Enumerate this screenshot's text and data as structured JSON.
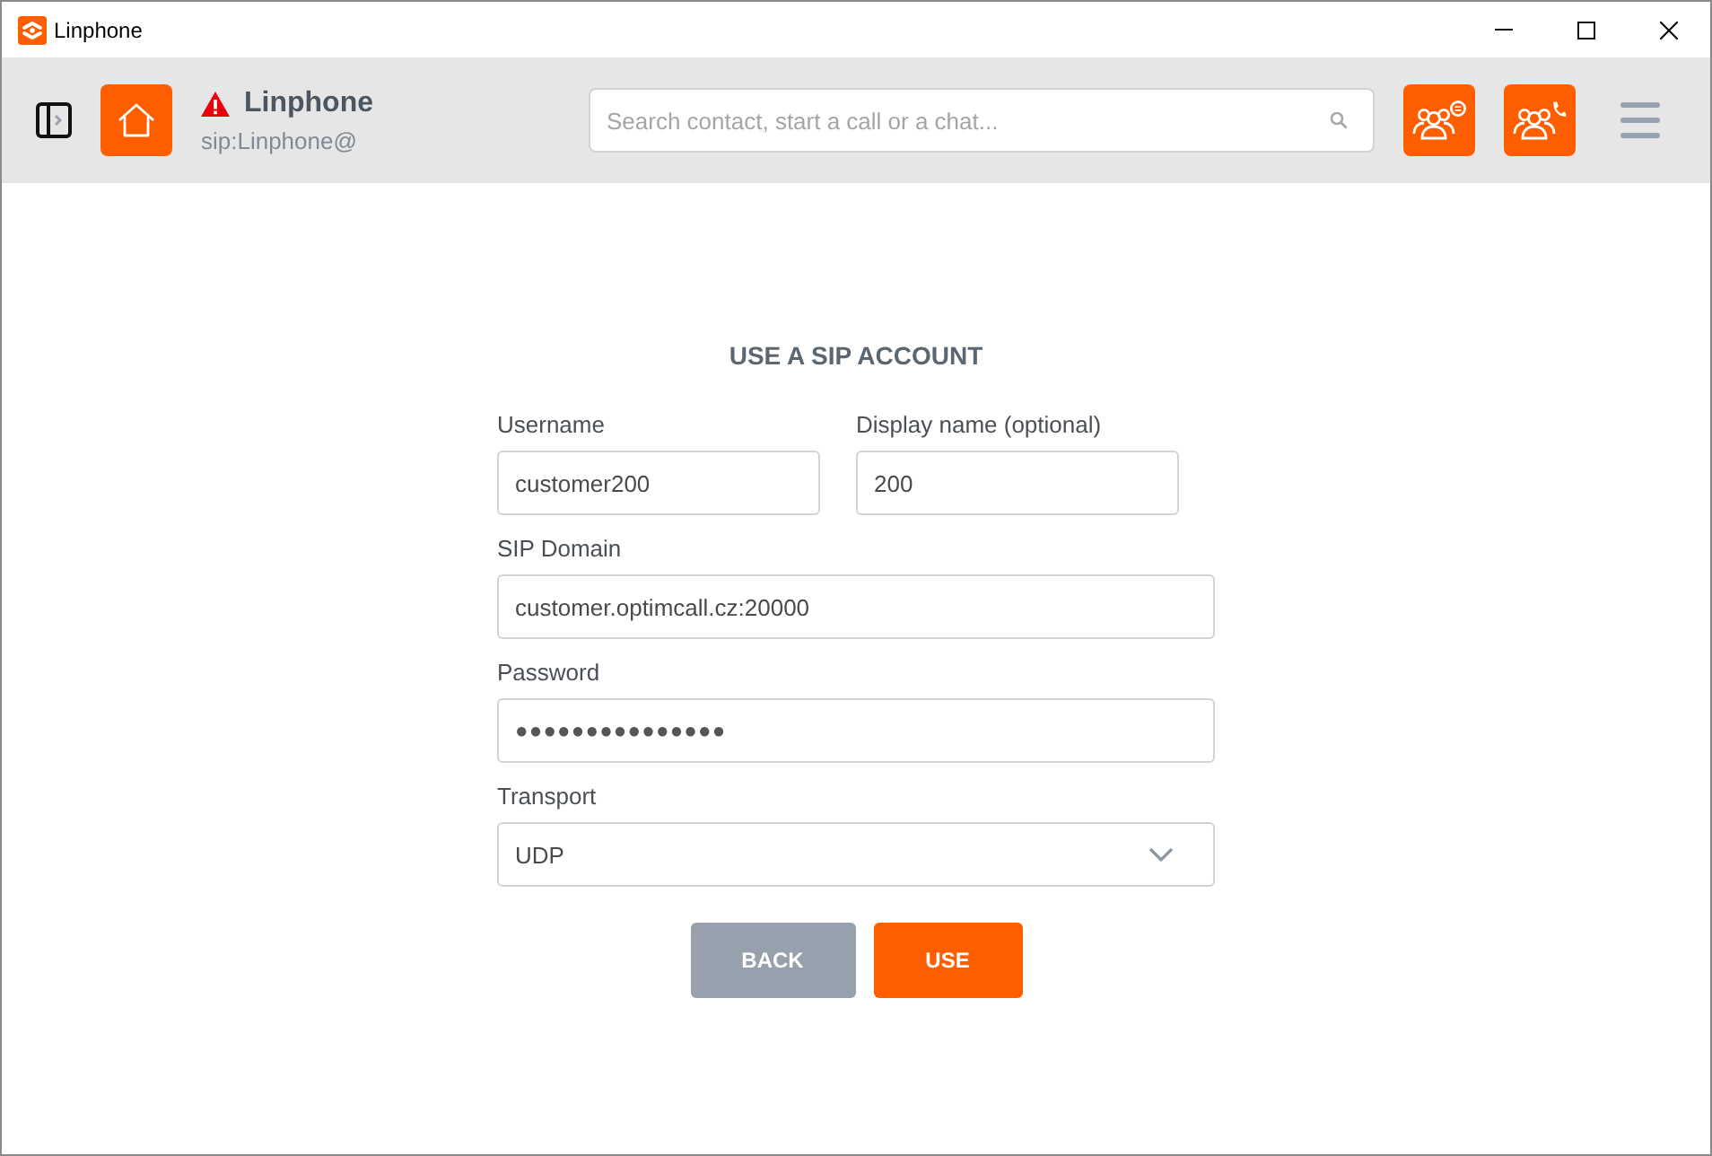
{
  "window": {
    "title": "Linphone"
  },
  "toolbar": {
    "account": {
      "name": "Linphone",
      "address": "sip:Linphone@",
      "warning": true
    },
    "search": {
      "placeholder": "Search contact, start a call or a chat..."
    }
  },
  "form": {
    "title": "USE A SIP ACCOUNT",
    "rows": [
      {
        "fields": [
          {
            "kind": "text",
            "label": "Username",
            "value": "customer200"
          },
          {
            "kind": "text",
            "label": "Display name (optional)",
            "value": "200"
          }
        ]
      },
      {
        "fields": [
          {
            "kind": "text",
            "label": "SIP Domain",
            "value": "customer.optimcall.cz:20000"
          }
        ]
      },
      {
        "fields": [
          {
            "kind": "password",
            "label": "Password",
            "value": "●●●●●●●●●●●●●●●"
          }
        ]
      },
      {
        "fields": [
          {
            "kind": "select",
            "label": "Transport",
            "value": "UDP"
          }
        ]
      }
    ],
    "buttons": [
      {
        "kind": "secondary",
        "label": "BACK"
      },
      {
        "kind": "primary",
        "label": "USE"
      }
    ]
  }
}
